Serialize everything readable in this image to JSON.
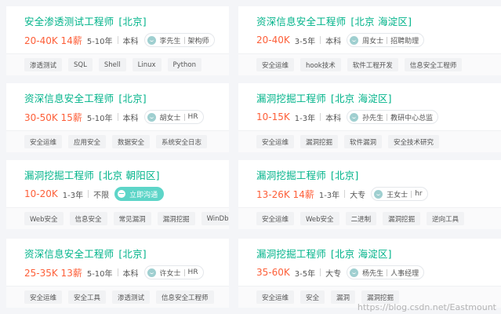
{
  "jobs": [
    {
      "title": "安全渗透测试工程师",
      "location": "[北京]",
      "salary": "20-40K 14薪",
      "experience": "5-10年",
      "education": "本科",
      "recruiter": "李先生",
      "recruiter_role": "架构师",
      "tags": [
        "渗透测试",
        "SQL",
        "Shell",
        "Linux",
        "Python"
      ]
    },
    {
      "title": "资深信息安全工程师",
      "location": "[北京 海淀区]",
      "salary": "20-40K",
      "experience": "3-5年",
      "education": "本科",
      "recruiter": "周女士",
      "recruiter_role": "招聘助理",
      "tags": [
        "安全运维",
        "hook技术",
        "软件工程开发",
        "信息安全工程师"
      ]
    },
    {
      "title": "资深信息安全工程师",
      "location": "[北京]",
      "salary": "30-50K 15薪",
      "experience": "5-10年",
      "education": "本科",
      "recruiter": "胡女士",
      "recruiter_role": "HR",
      "tags": [
        "安全运维",
        "应用安全",
        "数据安全",
        "系统安全日志"
      ]
    },
    {
      "title": "漏洞挖掘工程师",
      "location": "[北京 海淀区]",
      "salary": "10-15K",
      "experience": "1-3年",
      "education": "本科",
      "recruiter": "孙先生",
      "recruiter_role": "教研中心总监",
      "tags": [
        "安全运维",
        "漏洞挖掘",
        "软件漏洞",
        "安全技术研究"
      ]
    },
    {
      "title": "漏洞挖掘工程师",
      "location": "[北京 朝阳区]",
      "salary": "10-20K",
      "experience": "1-3年",
      "education": "不限",
      "chat_label": "立即沟通",
      "tags": [
        "Web安全",
        "信息安全",
        "常见漏洞",
        "漏洞挖掘",
        "WinDbg"
      ]
    },
    {
      "title": "漏洞挖掘工程师",
      "location": "[北京]",
      "salary": "13-26K 14薪",
      "experience": "1-3年",
      "education": "大专",
      "recruiter": "王女士",
      "recruiter_role": "hr",
      "tags": [
        "安全运维",
        "Web安全",
        "二进制",
        "漏洞挖掘",
        "逆向工具"
      ]
    },
    {
      "title": "资深信息安全工程师",
      "location": "[北京]",
      "salary": "25-35K 13薪",
      "experience": "5-10年",
      "education": "本科",
      "recruiter": "许女士",
      "recruiter_role": "HR",
      "tags": [
        "安全运维",
        "安全工具",
        "渗透测试",
        "信息安全工程师"
      ]
    },
    {
      "title": "漏洞挖掘工程师",
      "location": "[北京 海淀区]",
      "salary": "35-60K",
      "experience": "3-5年",
      "education": "大专",
      "recruiter": "杨先生",
      "recruiter_role": "人事经理",
      "tags": [
        "安全运维",
        "安全",
        "漏洞",
        "漏洞挖掘"
      ]
    }
  ],
  "watermark": "https://blog.csdn.net/Eastmount"
}
